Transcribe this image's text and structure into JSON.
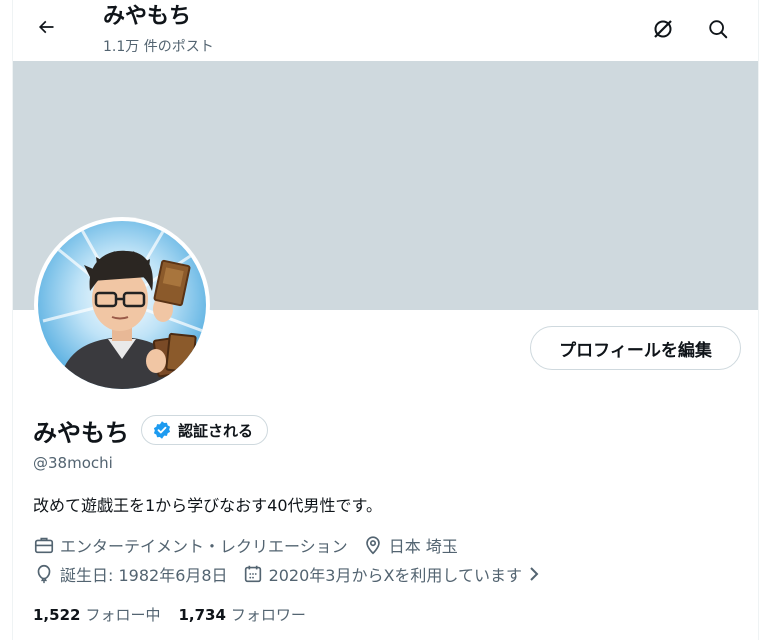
{
  "header": {
    "title": "みやもち",
    "post_count": "1.1万 件のポスト"
  },
  "profile": {
    "display_name": "みやもち",
    "verified_label": "認証される",
    "handle": "@38mochi",
    "bio": "改めて遊戯王を1から学びなおす40代男性です。",
    "edit_button": "プロフィールを編集",
    "category": "エンターテイメント・レクリエーション",
    "location": "日本 埼玉",
    "birthday": "誕生日: 1982年6月8日",
    "joined": "2020年3月からXを利用しています"
  },
  "stats": {
    "following_count": "1,522",
    "following_label": "フォロー中",
    "followers_count": "1,734",
    "followers_label": "フォロワー"
  },
  "colors": {
    "banner": "#cfd9de",
    "verified_blue": "#1d9bf0",
    "secondary_text": "#536471",
    "avatar_background": "#7cc2ea"
  }
}
